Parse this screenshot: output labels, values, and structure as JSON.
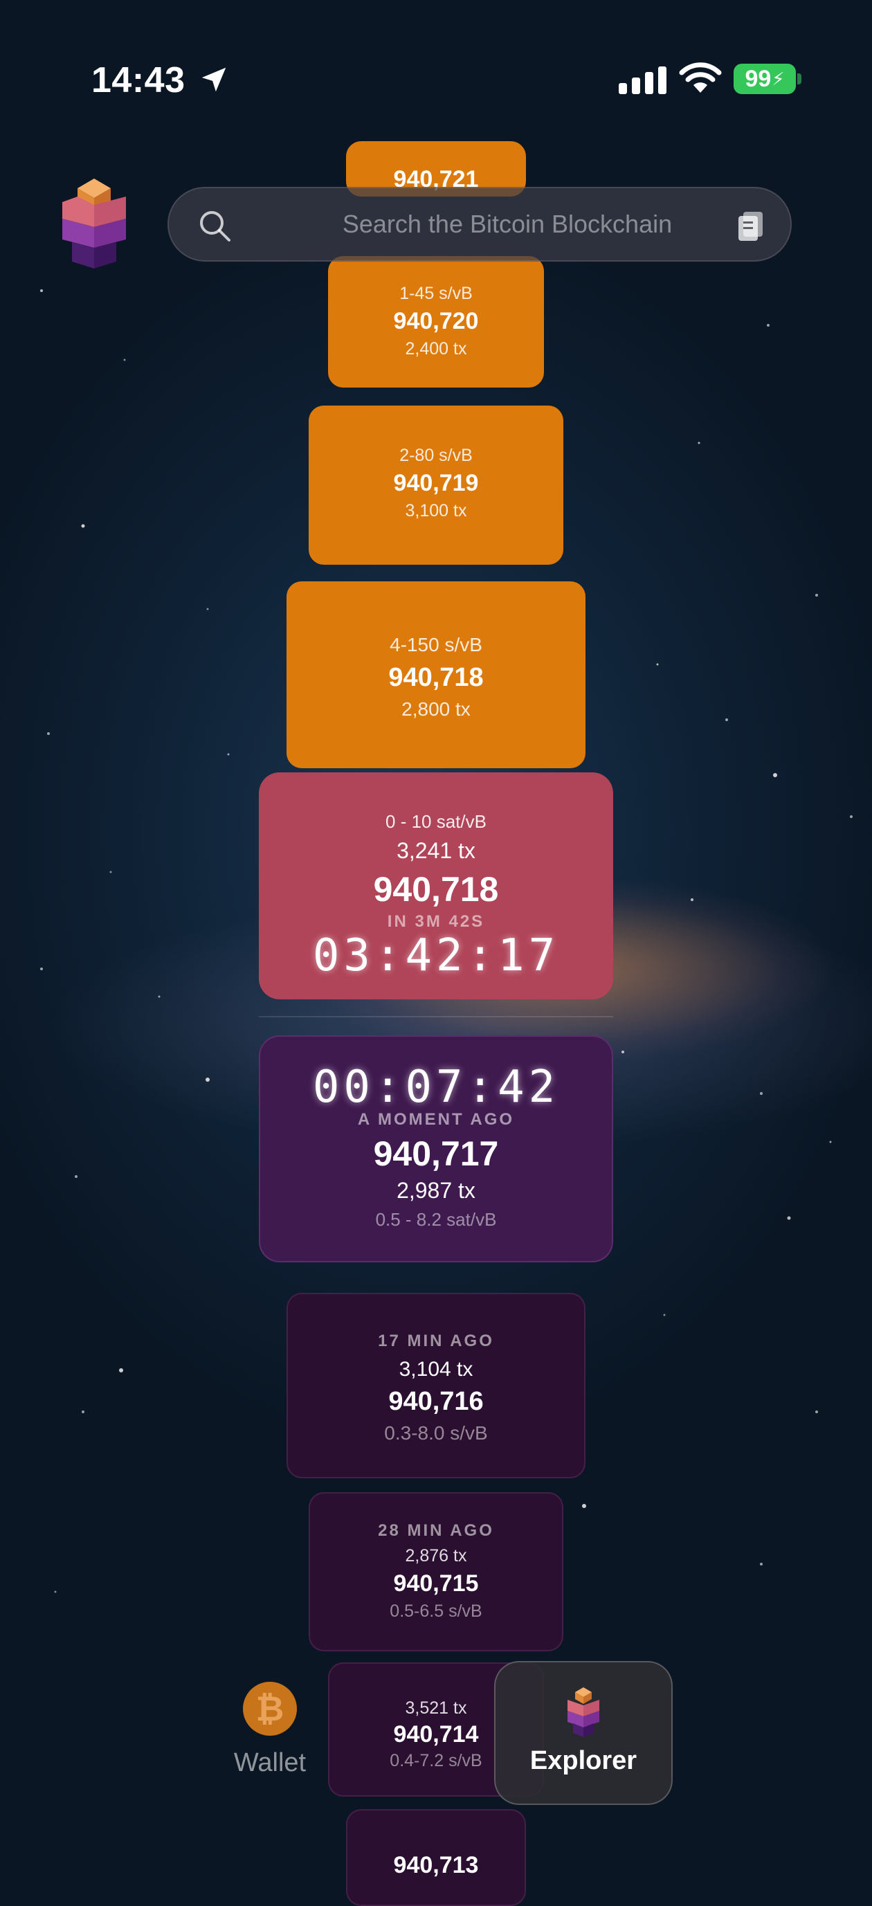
{
  "status_bar": {
    "time": "14:43",
    "battery": "99"
  },
  "search": {
    "placeholder": "Search the Bitcoin Blockchain"
  },
  "upcoming_blocks": [
    {
      "height": "940,721"
    },
    {
      "fee_range": "1-45 s/vB",
      "height": "940,720",
      "tx": "2,400 tx"
    },
    {
      "fee_range": "2-80 s/vB",
      "height": "940,719",
      "tx": "3,100 tx"
    },
    {
      "fee_range": "4-150 s/vB",
      "height": "940,718",
      "tx": "2,800 tx"
    }
  ],
  "next_block": {
    "fee_range": "0 - 10 sat/vB",
    "tx": "3,241 tx",
    "height": "940,718",
    "eta": "IN 3M 42S",
    "countdown": "03:42:17"
  },
  "latest_block": {
    "elapsed": "00:07:42",
    "age": "A MOMENT AGO",
    "height": "940,717",
    "tx": "2,987 tx",
    "fee_range": "0.5 - 8.2 sat/vB"
  },
  "past_blocks": [
    {
      "age": "17 MIN AGO",
      "tx": "3,104 tx",
      "height": "940,716",
      "fee_range": "0.3-8.0 s/vB"
    },
    {
      "age": "28 MIN AGO",
      "tx": "2,876 tx",
      "height": "940,715",
      "fee_range": "0.5-6.5 s/vB"
    },
    {
      "tx": "3,521 tx",
      "height": "940,714",
      "fee_range": "0.4-7.2 s/vB"
    },
    {
      "height": "940,713"
    }
  ],
  "tabs": {
    "wallet": "Wallet",
    "explorer": "Explorer"
  },
  "colors": {
    "orange": "#dd7a0c",
    "red": "#b04458",
    "purple": "#3f1a4f",
    "battery": "#35c759"
  }
}
